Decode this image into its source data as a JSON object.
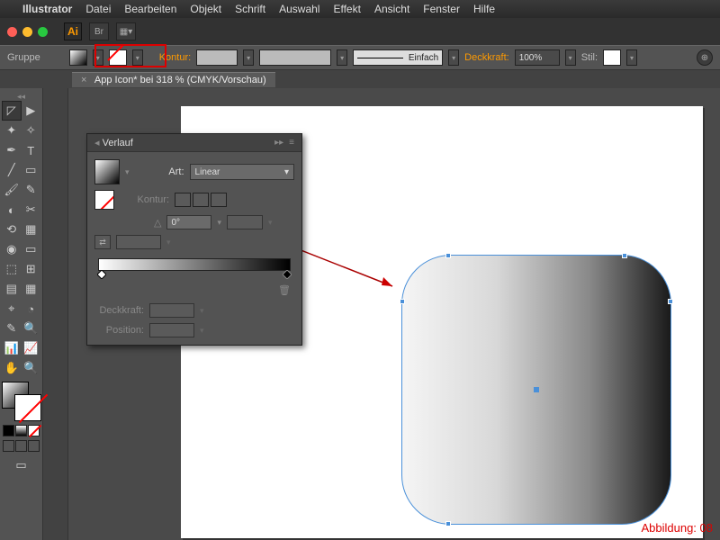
{
  "menubar": {
    "apple": "",
    "app": "Illustrator",
    "items": [
      "Datei",
      "Bearbeiten",
      "Objekt",
      "Schrift",
      "Auswahl",
      "Effekt",
      "Ansicht",
      "Fenster",
      "Hilfe"
    ]
  },
  "titlebar": {
    "logo": "Ai",
    "br": "Br"
  },
  "controlbar": {
    "selection": "Gruppe",
    "stroke_label": "Kontur:",
    "stroke_style": "Einfach",
    "opacity_label": "Deckkraft:",
    "opacity_value": "100%",
    "style_label": "Stil:"
  },
  "document": {
    "tab_label": "App Icon* bei 318 % (CMYK/Vorschau)",
    "close": "×"
  },
  "gradient_panel": {
    "title": "Verlauf",
    "type_label": "Art:",
    "type_value": "Linear",
    "stroke_label": "Kontur:",
    "angle_icon": "△",
    "angle_value": "0°",
    "reverse_icon": "⇄",
    "opacity_label": "Deckkraft:",
    "position_label": "Position:"
  },
  "tool_icons": [
    "◸",
    "▶",
    "✦",
    "✧",
    "✒",
    "T",
    "╱",
    "▭",
    "🖌",
    "✎",
    "◐",
    "✂",
    "⟲",
    "▦",
    "◉",
    "▭",
    "⬚",
    "⊞",
    "▤",
    "▦",
    "⌖",
    "◔",
    "✎",
    "🔍",
    "📊",
    "📈",
    "⊡",
    "⌗",
    "▭",
    "🔍",
    "✋",
    "🔍"
  ],
  "fill_modes": {
    "solid": "#000",
    "grad": "grad",
    "none": "none"
  },
  "caption": "Abbildung: 08"
}
